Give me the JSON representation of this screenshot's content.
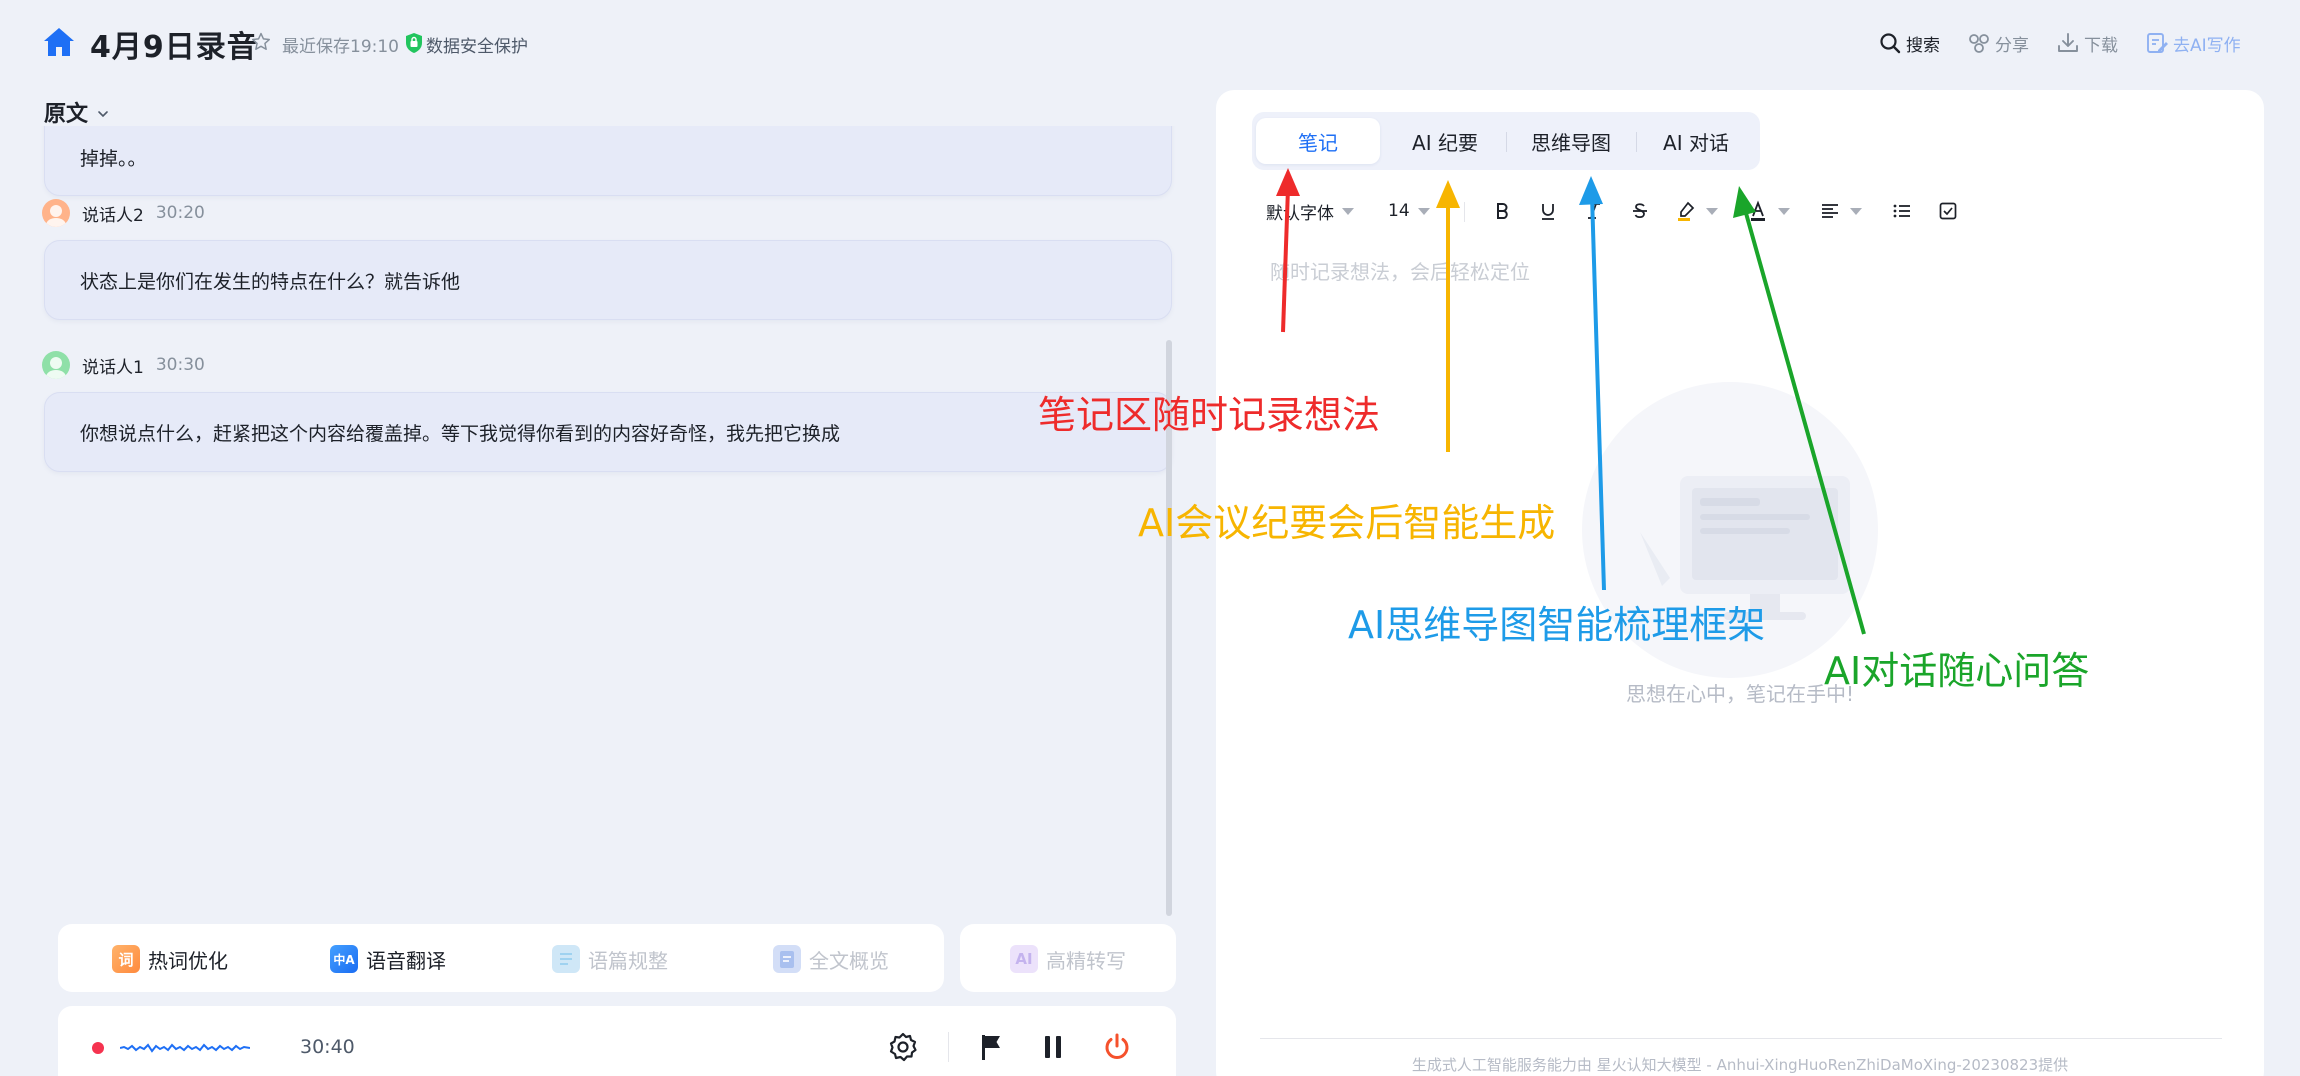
{
  "header": {
    "title": "4月9日录音",
    "save_status": "最近保存19:10",
    "security": "数据安全保护",
    "actions": {
      "search": "搜索",
      "share": "分享",
      "download": "下载",
      "ai_write": "去AI写作"
    }
  },
  "transcript": {
    "view_label": "原文",
    "partial_text": "掉掉。。",
    "entries": [
      {
        "speaker": "说话人2",
        "time": "30:20",
        "avatar_color": "#ffb38a",
        "text": "状态上是你们在发生的特点在什么？就告诉他"
      },
      {
        "speaker": "说话人1",
        "time": "30:30",
        "avatar_color": "#8fe0a8",
        "text": "你想说点什么，赶紧把这个内容给覆盖掉。等下我觉得你看到的内容好奇怪，我先把它换成"
      }
    ]
  },
  "tools": {
    "hotword": {
      "icon_text": "词",
      "label": "热词优化"
    },
    "translate": {
      "icon_text": "中A",
      "label": "语音翻译"
    },
    "regulate": {
      "label": "语篇规整"
    },
    "overview": {
      "label": "全文概览"
    },
    "precise": {
      "label": "高精转写"
    }
  },
  "recorder": {
    "elapsed": "30:40",
    "dot_color": "#f5334f",
    "power_color": "#f5512c"
  },
  "notes": {
    "tabs": [
      "笔记",
      "AI 纪要",
      "思维导图",
      "AI 对话"
    ],
    "active_tab": 0,
    "toolbar": {
      "font": "默认字体",
      "size": "14"
    },
    "placeholder": "随时记录想法，会后轻松定位",
    "empty_text": "思想在心中，笔记在手中!",
    "footer": "生成式人工智能服务能力由 星火认知大模型 - Anhui-XingHuoRenZhiDaMoXing-20230823提供"
  },
  "annotations": {
    "notes": "笔记区随时记录想法",
    "summary": "AI会议纪要会后智能生成",
    "mindmap": "AI思维导图智能梳理框架",
    "chat": "AI对话随心问答",
    "colors": {
      "notes": "#ee2b2b",
      "summary": "#f7b501",
      "mindmap": "#1e9be8",
      "chat": "#1aa52a"
    }
  }
}
